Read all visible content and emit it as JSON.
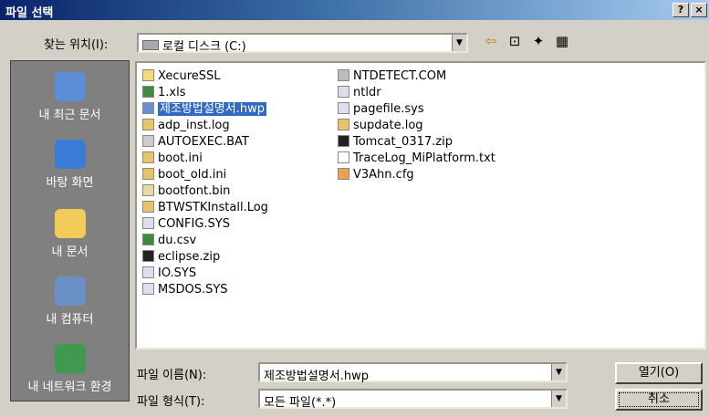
{
  "window": {
    "title": "파일 선택",
    "help_label": "?",
    "close_label": "×"
  },
  "lookin": {
    "label": "찾는 위치(I):",
    "value": "로컬 디스크 (C:)"
  },
  "places": [
    {
      "label": "내 최근 문서",
      "icon": "recent-icon"
    },
    {
      "label": "바탕 화면",
      "icon": "desktop-icon"
    },
    {
      "label": "내 문서",
      "icon": "mydocs-icon"
    },
    {
      "label": "내 컴퓨터",
      "icon": "computer-icon"
    },
    {
      "label": "내 네트워크 환경",
      "icon": "network-icon"
    }
  ],
  "files_col1": [
    {
      "name": "XecureSSL",
      "icon": "folder-icon"
    },
    {
      "name": "1.xls",
      "icon": "excel-icon"
    },
    {
      "name": "제조방법설명서.hwp",
      "icon": "hwp-icon",
      "selected": true
    },
    {
      "name": "adp_inst.log",
      "icon": "log-icon"
    },
    {
      "name": "AUTOEXEC.BAT",
      "icon": "bat-icon"
    },
    {
      "name": "boot.ini",
      "icon": "ini-icon"
    },
    {
      "name": "boot_old.ini",
      "icon": "ini-icon"
    },
    {
      "name": "bootfont.bin",
      "icon": "bin-icon"
    },
    {
      "name": "BTWSTKInstall.Log",
      "icon": "log-icon"
    },
    {
      "name": "CONFIG.SYS",
      "icon": "sys-icon"
    },
    {
      "name": "du.csv",
      "icon": "excel-icon"
    },
    {
      "name": "eclipse.zip",
      "icon": "zip-icon"
    },
    {
      "name": "IO.SYS",
      "icon": "sys-icon"
    },
    {
      "name": "MSDOS.SYS",
      "icon": "sys-icon"
    }
  ],
  "files_col2": [
    {
      "name": "NTDETECT.COM",
      "icon": "com-icon"
    },
    {
      "name": "ntldr",
      "icon": "sys-icon"
    },
    {
      "name": "pagefile.sys",
      "icon": "sys-icon"
    },
    {
      "name": "supdate.log",
      "icon": "log-icon"
    },
    {
      "name": "Tomcat_0317.zip",
      "icon": "zip-icon"
    },
    {
      "name": "TraceLog_MiPlatform.txt",
      "icon": "txt-icon"
    },
    {
      "name": "V3Ahn.cfg",
      "icon": "cfg-icon"
    }
  ],
  "filename": {
    "label": "파일 이름(N):",
    "value": "제조방법설명서.hwp"
  },
  "filetype": {
    "label": "파일 형식(T):",
    "value": "모든 파일(*.*)"
  },
  "buttons": {
    "open": "열기(O)",
    "cancel": "취소"
  }
}
